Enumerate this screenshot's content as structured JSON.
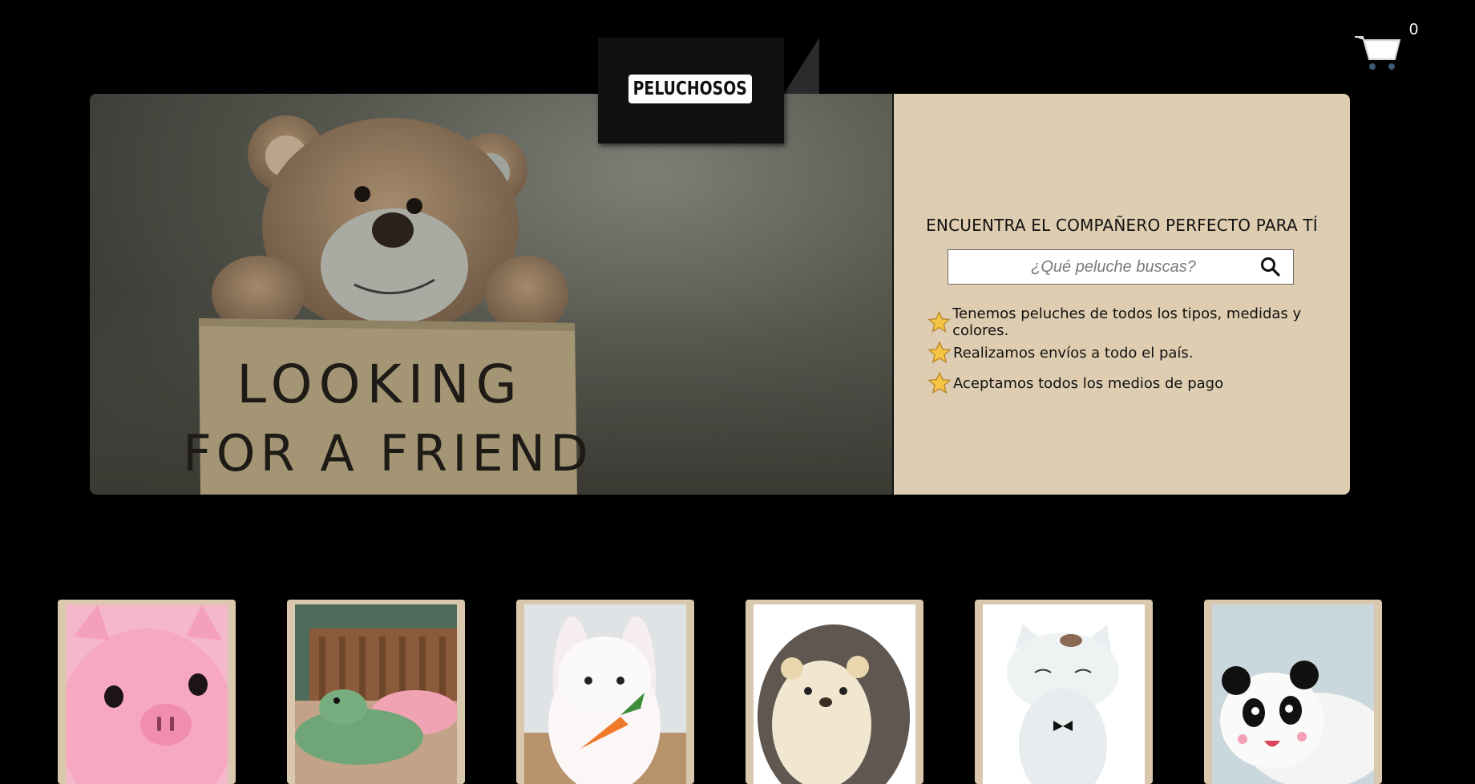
{
  "cart": {
    "count": "0",
    "icon": "cart-icon"
  },
  "logo": {
    "text": "PELUCHOSOS"
  },
  "hero": {
    "image_caption_line1": "LOOKING",
    "image_caption_line2": "FOR A FRIEND",
    "title": "ENCUENTRA EL COMPAÑERO PERFECTO PARA TÍ",
    "search": {
      "placeholder": "¿Qué peluche buscas?",
      "value": ""
    },
    "features": [
      {
        "icon": "star-icon",
        "text": "Tenemos peluches de todos los tipos, medidas y colores."
      },
      {
        "icon": "star-icon",
        "text": "Realizamos envíos a todo el país."
      },
      {
        "icon": "star-icon",
        "text": "Aceptamos todos los medios de pago"
      }
    ]
  },
  "products": [
    {
      "name": "pig-plush",
      "bg": "#f3a9c0"
    },
    {
      "name": "crocodile-plush",
      "bg": "#5f7a68"
    },
    {
      "name": "bunny-plush",
      "bg": "#d8dde0"
    },
    {
      "name": "hedgehog-plush",
      "bg": "#ffffff"
    },
    {
      "name": "cat-plush",
      "bg": "#ffffff"
    },
    {
      "name": "panda-plush",
      "bg": "#c9d6dc"
    }
  ],
  "colors": {
    "background": "#000000",
    "panel": "#decdb0",
    "card_frame": "#d9c8ad"
  }
}
